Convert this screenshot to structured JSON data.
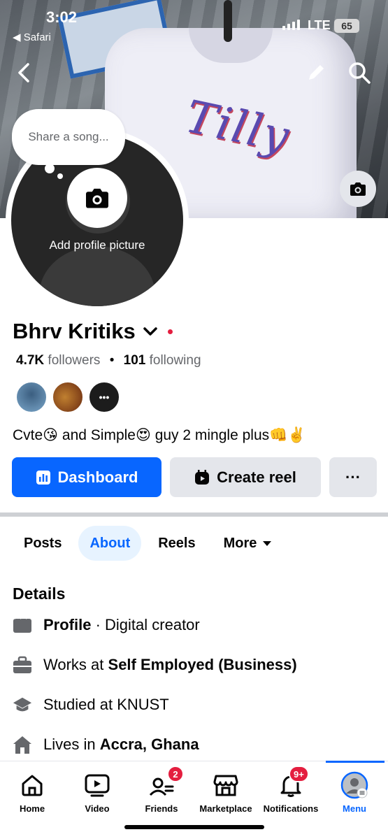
{
  "status_bar": {
    "time": "3:02",
    "back_app": "Safari",
    "network": "LTE",
    "battery": "65"
  },
  "cover": {
    "brand_text": "Tilly"
  },
  "avatar": {
    "thought_placeholder": "Share a song...",
    "add_label": "Add profile picture"
  },
  "profile": {
    "name": "Bhrv Kritiks",
    "followers_count": "4.7K",
    "followers_label": "followers",
    "separator": "•",
    "following_count": "101",
    "following_label": "following",
    "bio": "Cvte😘 and Simple😍 guy 2 mingle plus👊✌️"
  },
  "actions": {
    "dashboard": "Dashboard",
    "create_reel": "Create reel",
    "more": "···"
  },
  "tabs": [
    {
      "label": "Posts"
    },
    {
      "label": "About"
    },
    {
      "label": "Reels"
    },
    {
      "label": "More"
    }
  ],
  "details": {
    "title": "Details",
    "profile_bold": "Profile",
    "profile_rest": " · Digital creator",
    "works_prefix": "Works at ",
    "works_bold": "Self Employed (Business)",
    "studied": "Studied at KNUST",
    "lives_prefix": "Lives in ",
    "lives_bold": "Accra, Ghana"
  },
  "bottom_nav": [
    {
      "label": "Home"
    },
    {
      "label": "Video"
    },
    {
      "label": "Friends",
      "badge": "2"
    },
    {
      "label": "Marketplace"
    },
    {
      "label": "Notifications",
      "badge": "9+"
    },
    {
      "label": "Menu"
    }
  ],
  "colors": {
    "accent": "#0866ff",
    "badge": "#e41e3f",
    "secondary_btn": "#e4e6eb",
    "muted_text": "#65676b"
  }
}
